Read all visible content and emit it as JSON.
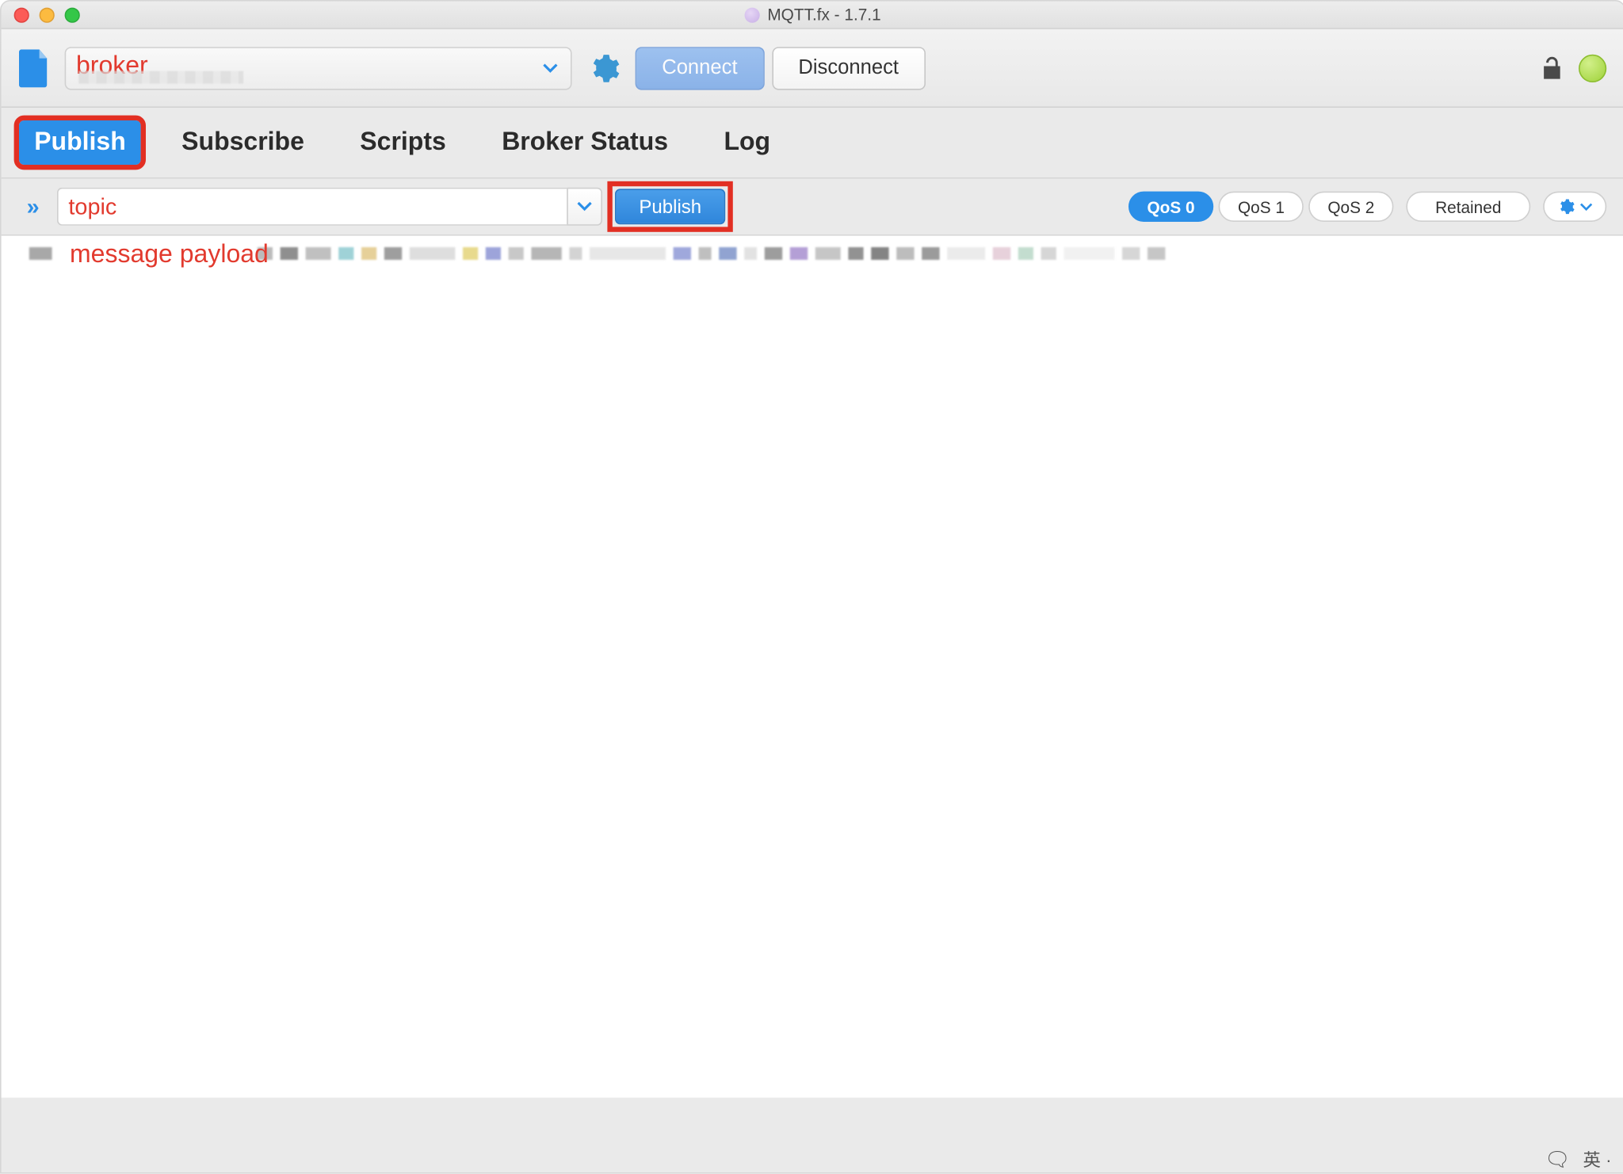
{
  "titlebar": {
    "title": "MQTT.fx - 1.7.1"
  },
  "toolbar": {
    "broker_label": "broker",
    "connect_label": "Connect",
    "disconnect_label": "Disconnect"
  },
  "tabs": {
    "items": [
      {
        "label": "Publish",
        "active": true
      },
      {
        "label": "Subscribe",
        "active": false
      },
      {
        "label": "Scripts",
        "active": false
      },
      {
        "label": "Broker Status",
        "active": false
      },
      {
        "label": "Log",
        "active": false
      }
    ]
  },
  "publish": {
    "topic_value": "topic",
    "publish_label": "Publish",
    "qos": [
      {
        "label": "QoS 0",
        "active": true
      },
      {
        "label": "QoS 1",
        "active": false
      },
      {
        "label": "QoS 2",
        "active": false
      }
    ],
    "retained_label": "Retained"
  },
  "payload": {
    "label": "message payload"
  }
}
